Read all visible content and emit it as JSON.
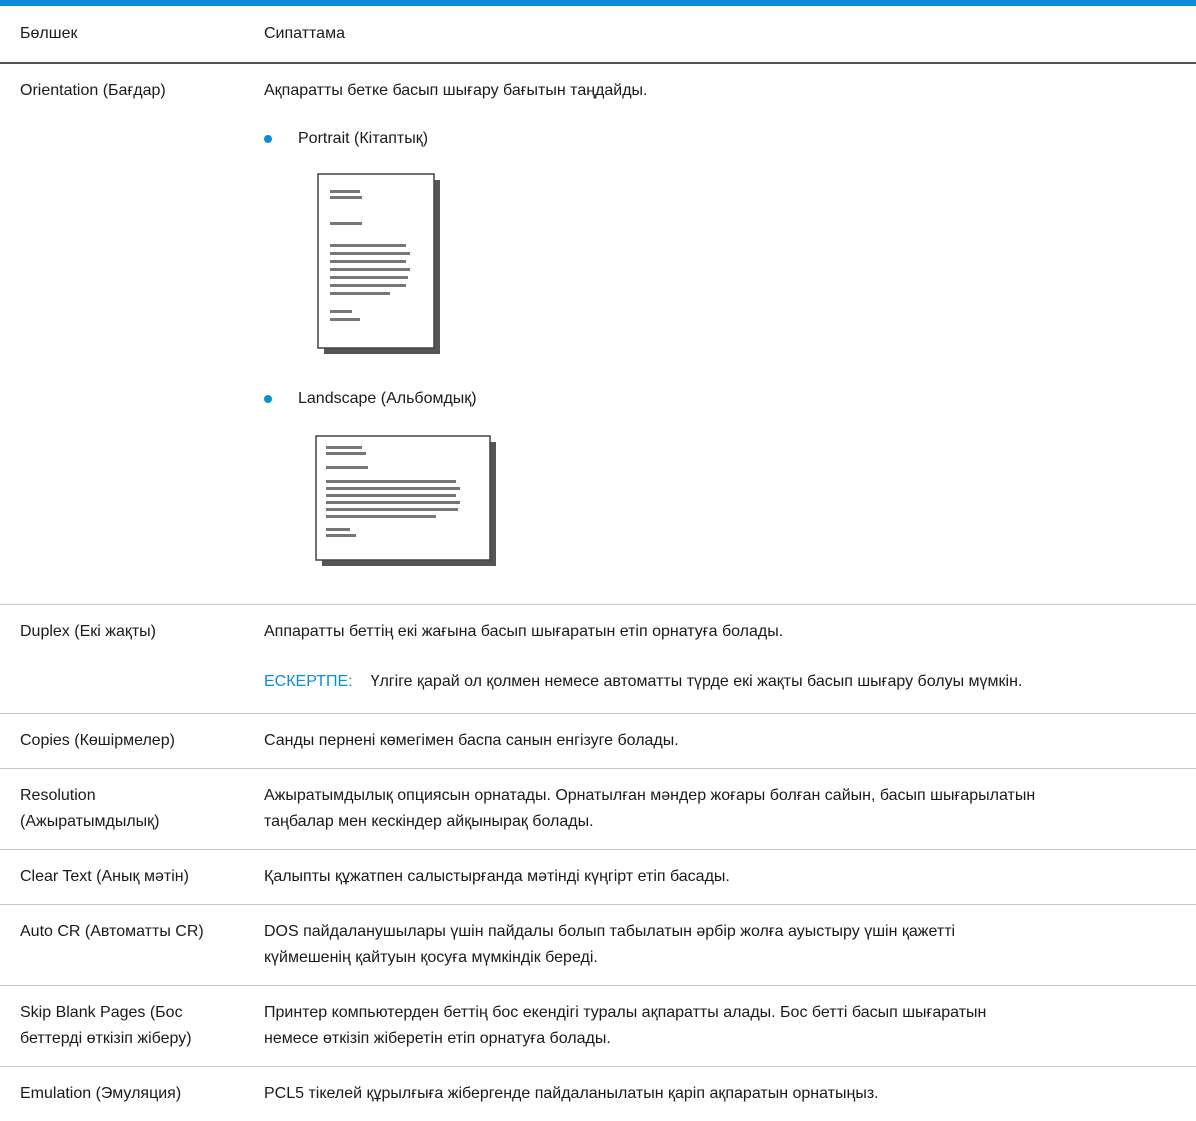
{
  "header": {
    "col1": "Бөлшек",
    "col2": "Сипаттама"
  },
  "orientation": {
    "name": "Orientation (Бағдар)",
    "desc": "Ақпаратты бетке басып шығару бағытын таңдайды.",
    "portrait": "Portrait (Кітаптық)",
    "landscape": "Landscape (Альбомдық)",
    "portrait_icon": "portrait-page-icon",
    "landscape_icon": "landscape-page-icon"
  },
  "duplex": {
    "name": "Duplex (Екі жақты)",
    "desc": "Аппаратты беттің екі жағына басып шығаратын етіп орнатуға болады.",
    "note_label": "ЕСКЕРТПЕ:",
    "note_text": "Үлгіге қарай ол қолмен немесе автоматты түрде екі жақты басып шығару болуы мүмкін."
  },
  "copies": {
    "name": "Copies (Көшірмелер)",
    "desc": "Санды пернені көмегімен баспа санын енгізуге болады."
  },
  "resolution": {
    "name_line1": "Resolution",
    "name_line2": "(Ажыратымдылық)",
    "desc_line1": "Ажыратымдылық опциясын орнатады. Орнатылған мәндер жоғары болған сайын, басып шығарылатын",
    "desc_line2": "таңбалар мен кескіндер айқынырақ болады."
  },
  "clear_text": {
    "name": "Clear Text (Анық мәтін)",
    "desc": "Қалыпты құжатпен салыстырғанда мәтінді күңгірт етіп басады."
  },
  "auto_cr": {
    "name": "Auto CR (Автоматты CR)",
    "desc_line1": "DOS пайдаланушылары үшін пайдалы болып табылатын әрбір жолға ауыстыру үшін қажетті",
    "desc_line2": "күймешенің қайтуын қосуға мүмкіндік береді."
  },
  "skip_blank": {
    "name_line1": "Skip Blank Pages (Бос",
    "name_line2": "беттерді өткізіп жіберу)",
    "desc_line1": "Принтер компьютерден беттің бос екендігі туралы ақпаратты алады. Бос бетті басып шығаратын",
    "desc_line2": "немесе өткізіп жіберетін етіп орнатуға болады."
  },
  "emulation": {
    "name": "Emulation (Эмуляция)",
    "desc": "PCL5 тікелей құрылғыға жібергенде пайдаланылатын қаріп ақпаратын орнатыңыз."
  },
  "colors": {
    "accent": "#0a8fd6"
  }
}
